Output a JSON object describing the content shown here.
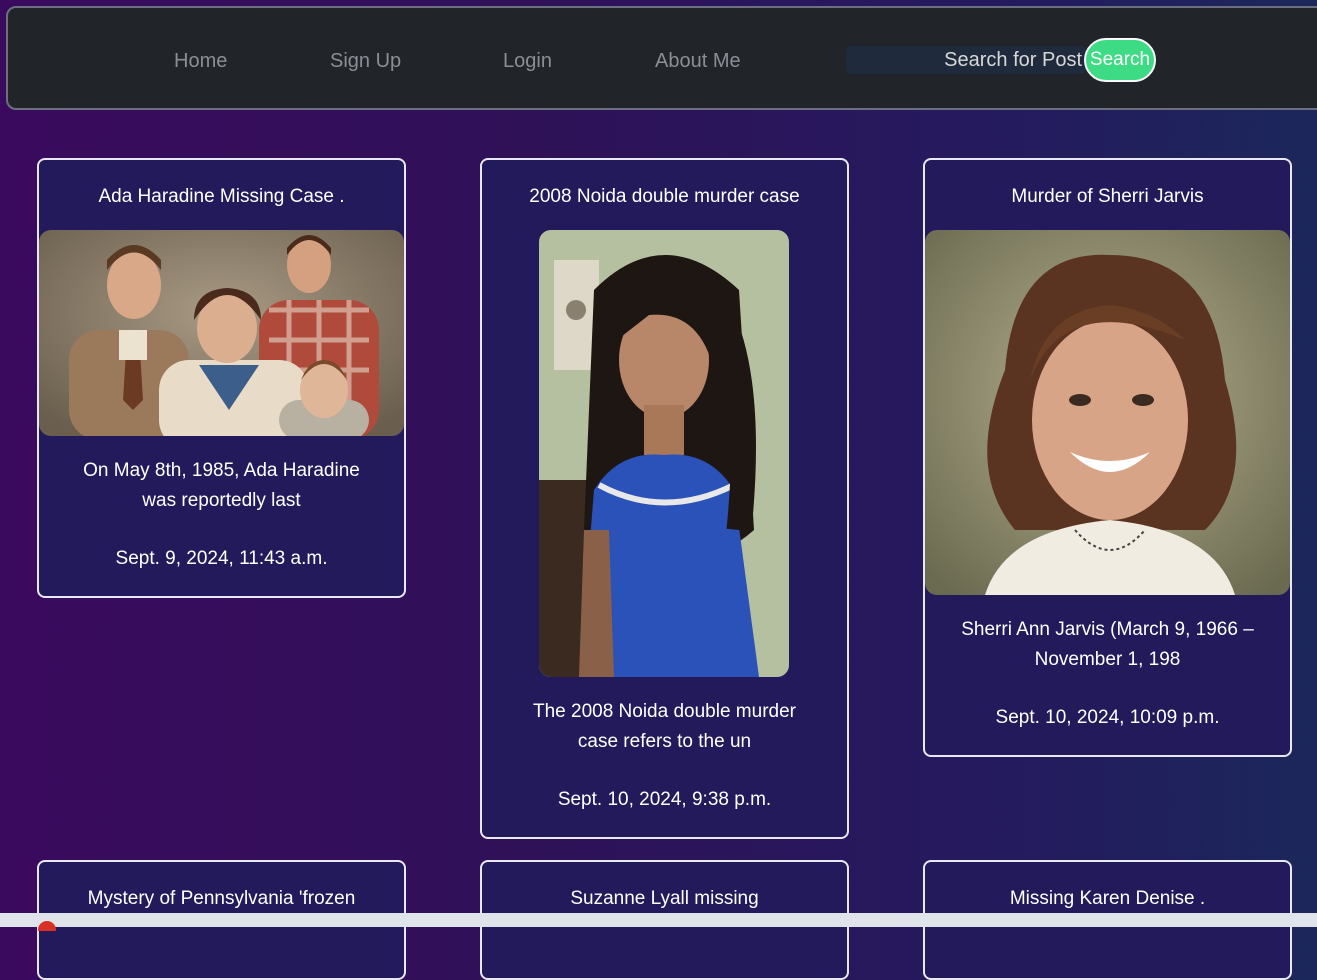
{
  "nav": {
    "links": [
      "Home",
      "Sign Up",
      "Login",
      "About Me"
    ],
    "search_placeholder": "Search for Post",
    "search_button": "Search"
  },
  "posts": [
    {
      "title": "Ada Haradine Missing Case .",
      "excerpt": "On May 8th, 1985, Ada Haradine was reportedly last",
      "date": "Sept. 9, 2024, 11:43 a.m."
    },
    {
      "title": "2008 Noida double murder case",
      "excerpt": "The 2008 Noida double murder case refers to the un",
      "date": "Sept. 10, 2024, 9:38 p.m."
    },
    {
      "title": "Murder of Sherri Jarvis",
      "excerpt": "Sherri Ann Jarvis (March 9, 1966 – November 1, 198",
      "date": "Sept. 10, 2024, 10:09 p.m."
    },
    {
      "title": "Mystery of Pennsylvania 'frozen"
    },
    {
      "title": "Suzanne Lyall missing"
    },
    {
      "title": "Missing Karen Denise ."
    }
  ],
  "colors": {
    "navbar_bg": "#212529",
    "search_button": "#3ddc84",
    "card_border": "#e8e8f0"
  }
}
